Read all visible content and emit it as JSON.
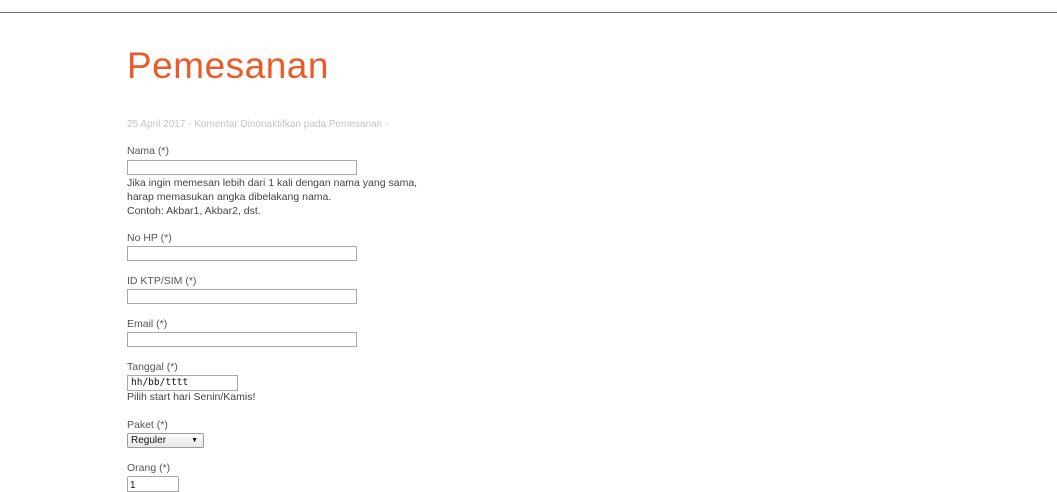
{
  "page": {
    "title": "Pemesanan",
    "meta": "25 April 2017 - Komentar Dinonaktifkan pada Pemesanan -"
  },
  "form": {
    "nama": {
      "label": "Nama (*)",
      "value": "",
      "hint_lines": [
        "Jika ingin memesan lebih dari 1 kali dengan nama yang sama,",
        "harap memasukan angka dibelakang nama.",
        "Contoh: Akbar1, Akbar2, dst."
      ]
    },
    "no_hp": {
      "label": "No HP (*)",
      "value": ""
    },
    "id_ktp": {
      "label": "ID KTP/SIM (*)",
      "value": ""
    },
    "email": {
      "label": "Email (*)",
      "value": ""
    },
    "tanggal": {
      "label": "Tanggal (*)",
      "placeholder": "hh/bb/tttt",
      "hint": "Pilih start hari Senin/Kamis!"
    },
    "paket": {
      "label": "Paket (*)",
      "selected": "Reguler"
    },
    "orang": {
      "label": "Orang (*)",
      "value": "1"
    }
  },
  "icons": {
    "select_arrow": "chevron-down-icon"
  },
  "colors": {
    "title": "#ea5b2a",
    "meta": "#c4c4c4",
    "text": "#444444",
    "rule": "#6b6b6b"
  }
}
